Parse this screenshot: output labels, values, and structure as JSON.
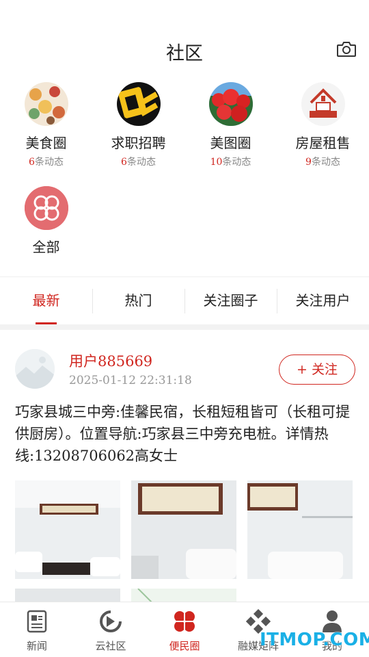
{
  "header": {
    "title": "社区"
  },
  "circles": [
    {
      "name": "美食圈",
      "count": "6",
      "count_suffix": "条动态",
      "icon": "food-collage"
    },
    {
      "name": "求职招聘",
      "count": "6",
      "count_suffix": "条动态",
      "icon": "hiring-sign"
    },
    {
      "name": "美图圈",
      "count": "10",
      "count_suffix": "条动态",
      "icon": "red-flowers"
    },
    {
      "name": "房屋租售",
      "count": "9",
      "count_suffix": "条动态",
      "icon": "house-rent"
    },
    {
      "name": "全部",
      "icon": "clover-grid"
    }
  ],
  "tabs": [
    {
      "label": "最新",
      "active": true
    },
    {
      "label": "热门",
      "active": false
    },
    {
      "label": "关注圈子",
      "active": false
    },
    {
      "label": "关注用户",
      "active": false
    }
  ],
  "post": {
    "username": "用户885669",
    "time": "2025-01-12 22:31:18",
    "follow_label": "+ 关注",
    "text": "巧家县城三中旁:佳馨民宿，长租短租皆可（长租可提供厨房）。位置导航:巧家县三中旁充电桩。详情热线:13208706062高女士",
    "images": [
      "room-photo",
      "room-photo",
      "room-photo",
      "room-photo",
      "map-photo"
    ]
  },
  "tabbar": [
    {
      "label": "新闻",
      "icon": "news-icon",
      "active": false
    },
    {
      "label": "云社区",
      "icon": "cloud-community-icon",
      "active": false
    },
    {
      "label": "便民圈",
      "icon": "clover-icon",
      "active": true
    },
    {
      "label": "融媒矩阵",
      "icon": "matrix-icon",
      "active": false
    },
    {
      "label": "我的",
      "icon": "user-icon",
      "active": false
    }
  ],
  "watermark": "ITMOP.COM",
  "colors": {
    "accent": "#d0261f",
    "text": "#222222",
    "muted": "#999999"
  }
}
